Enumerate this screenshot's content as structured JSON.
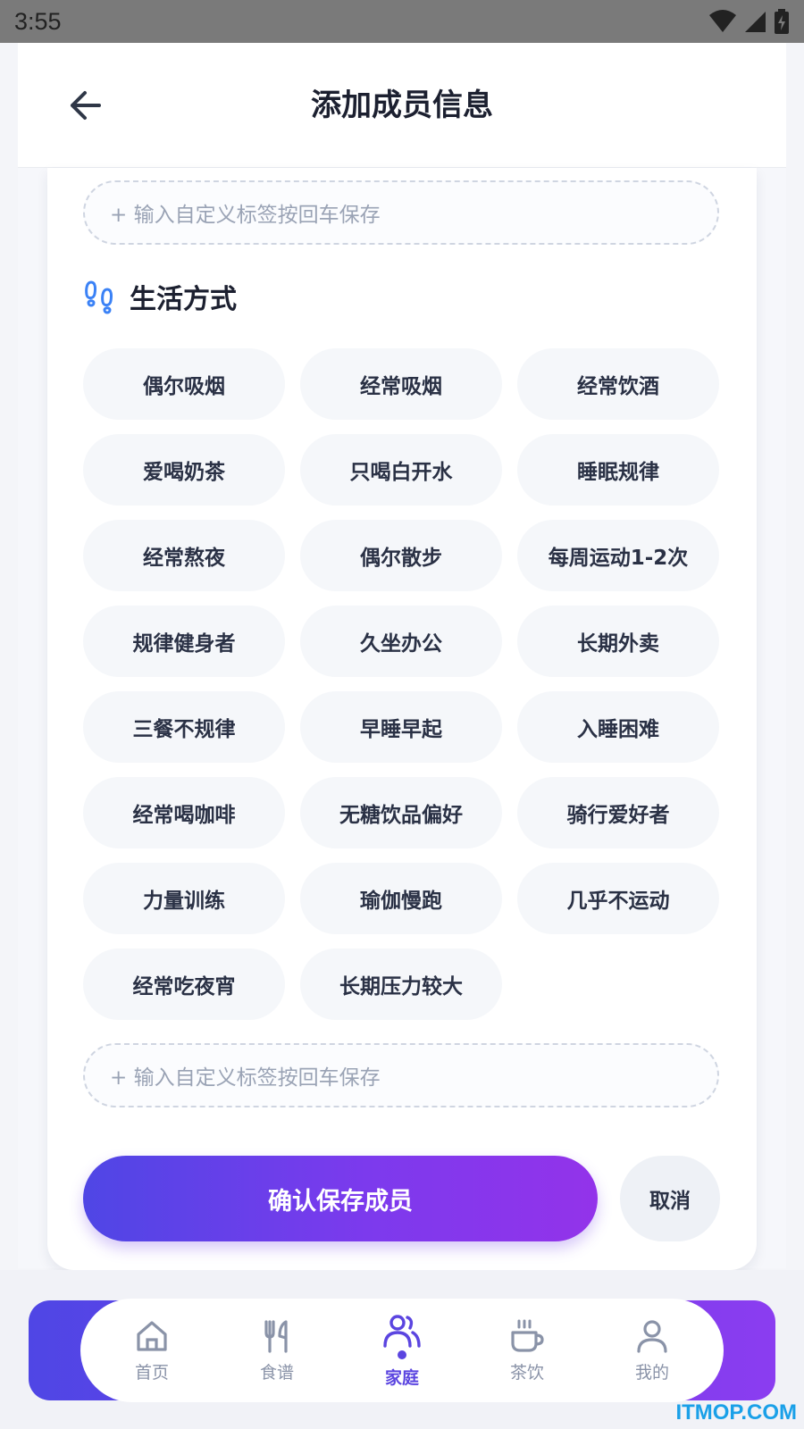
{
  "status_bar": {
    "time": "3:55"
  },
  "header": {
    "title": "添加成员信息"
  },
  "top_custom_input": {
    "placeholder": "+ 输入自定义标签按回车保存"
  },
  "lifestyle": {
    "title": "生活方式",
    "tags": [
      "偶尔吸烟",
      "经常吸烟",
      "经常饮酒",
      "爱喝奶茶",
      "只喝白开水",
      "睡眠规律",
      "经常熬夜",
      "偶尔散步",
      "每周运动1-2次",
      "规律健身者",
      "久坐办公",
      "长期外卖",
      "三餐不规律",
      "早睡早起",
      "入睡困难",
      "经常喝咖啡",
      "无糖饮品偏好",
      "骑行爱好者",
      "力量训练",
      "瑜伽慢跑",
      "几乎不运动",
      "经常吃夜宵",
      "长期压力较大"
    ],
    "custom_input_placeholder": "+ 输入自定义标签按回车保存"
  },
  "actions": {
    "confirm": "确认保存成员",
    "cancel": "取消"
  },
  "bottom_nav": {
    "items": [
      {
        "label": "首页",
        "icon": "home-icon"
      },
      {
        "label": "食谱",
        "icon": "fork-knife-icon"
      },
      {
        "label": "家庭",
        "icon": "family-icon",
        "active": true
      },
      {
        "label": "茶饮",
        "icon": "cup-icon"
      },
      {
        "label": "我的",
        "icon": "user-icon"
      }
    ]
  },
  "watermark": "ITMOP.COM",
  "colors": {
    "accent": "#5b45e0",
    "gradient_start": "#4f46e5",
    "gradient_end": "#9333ea"
  }
}
